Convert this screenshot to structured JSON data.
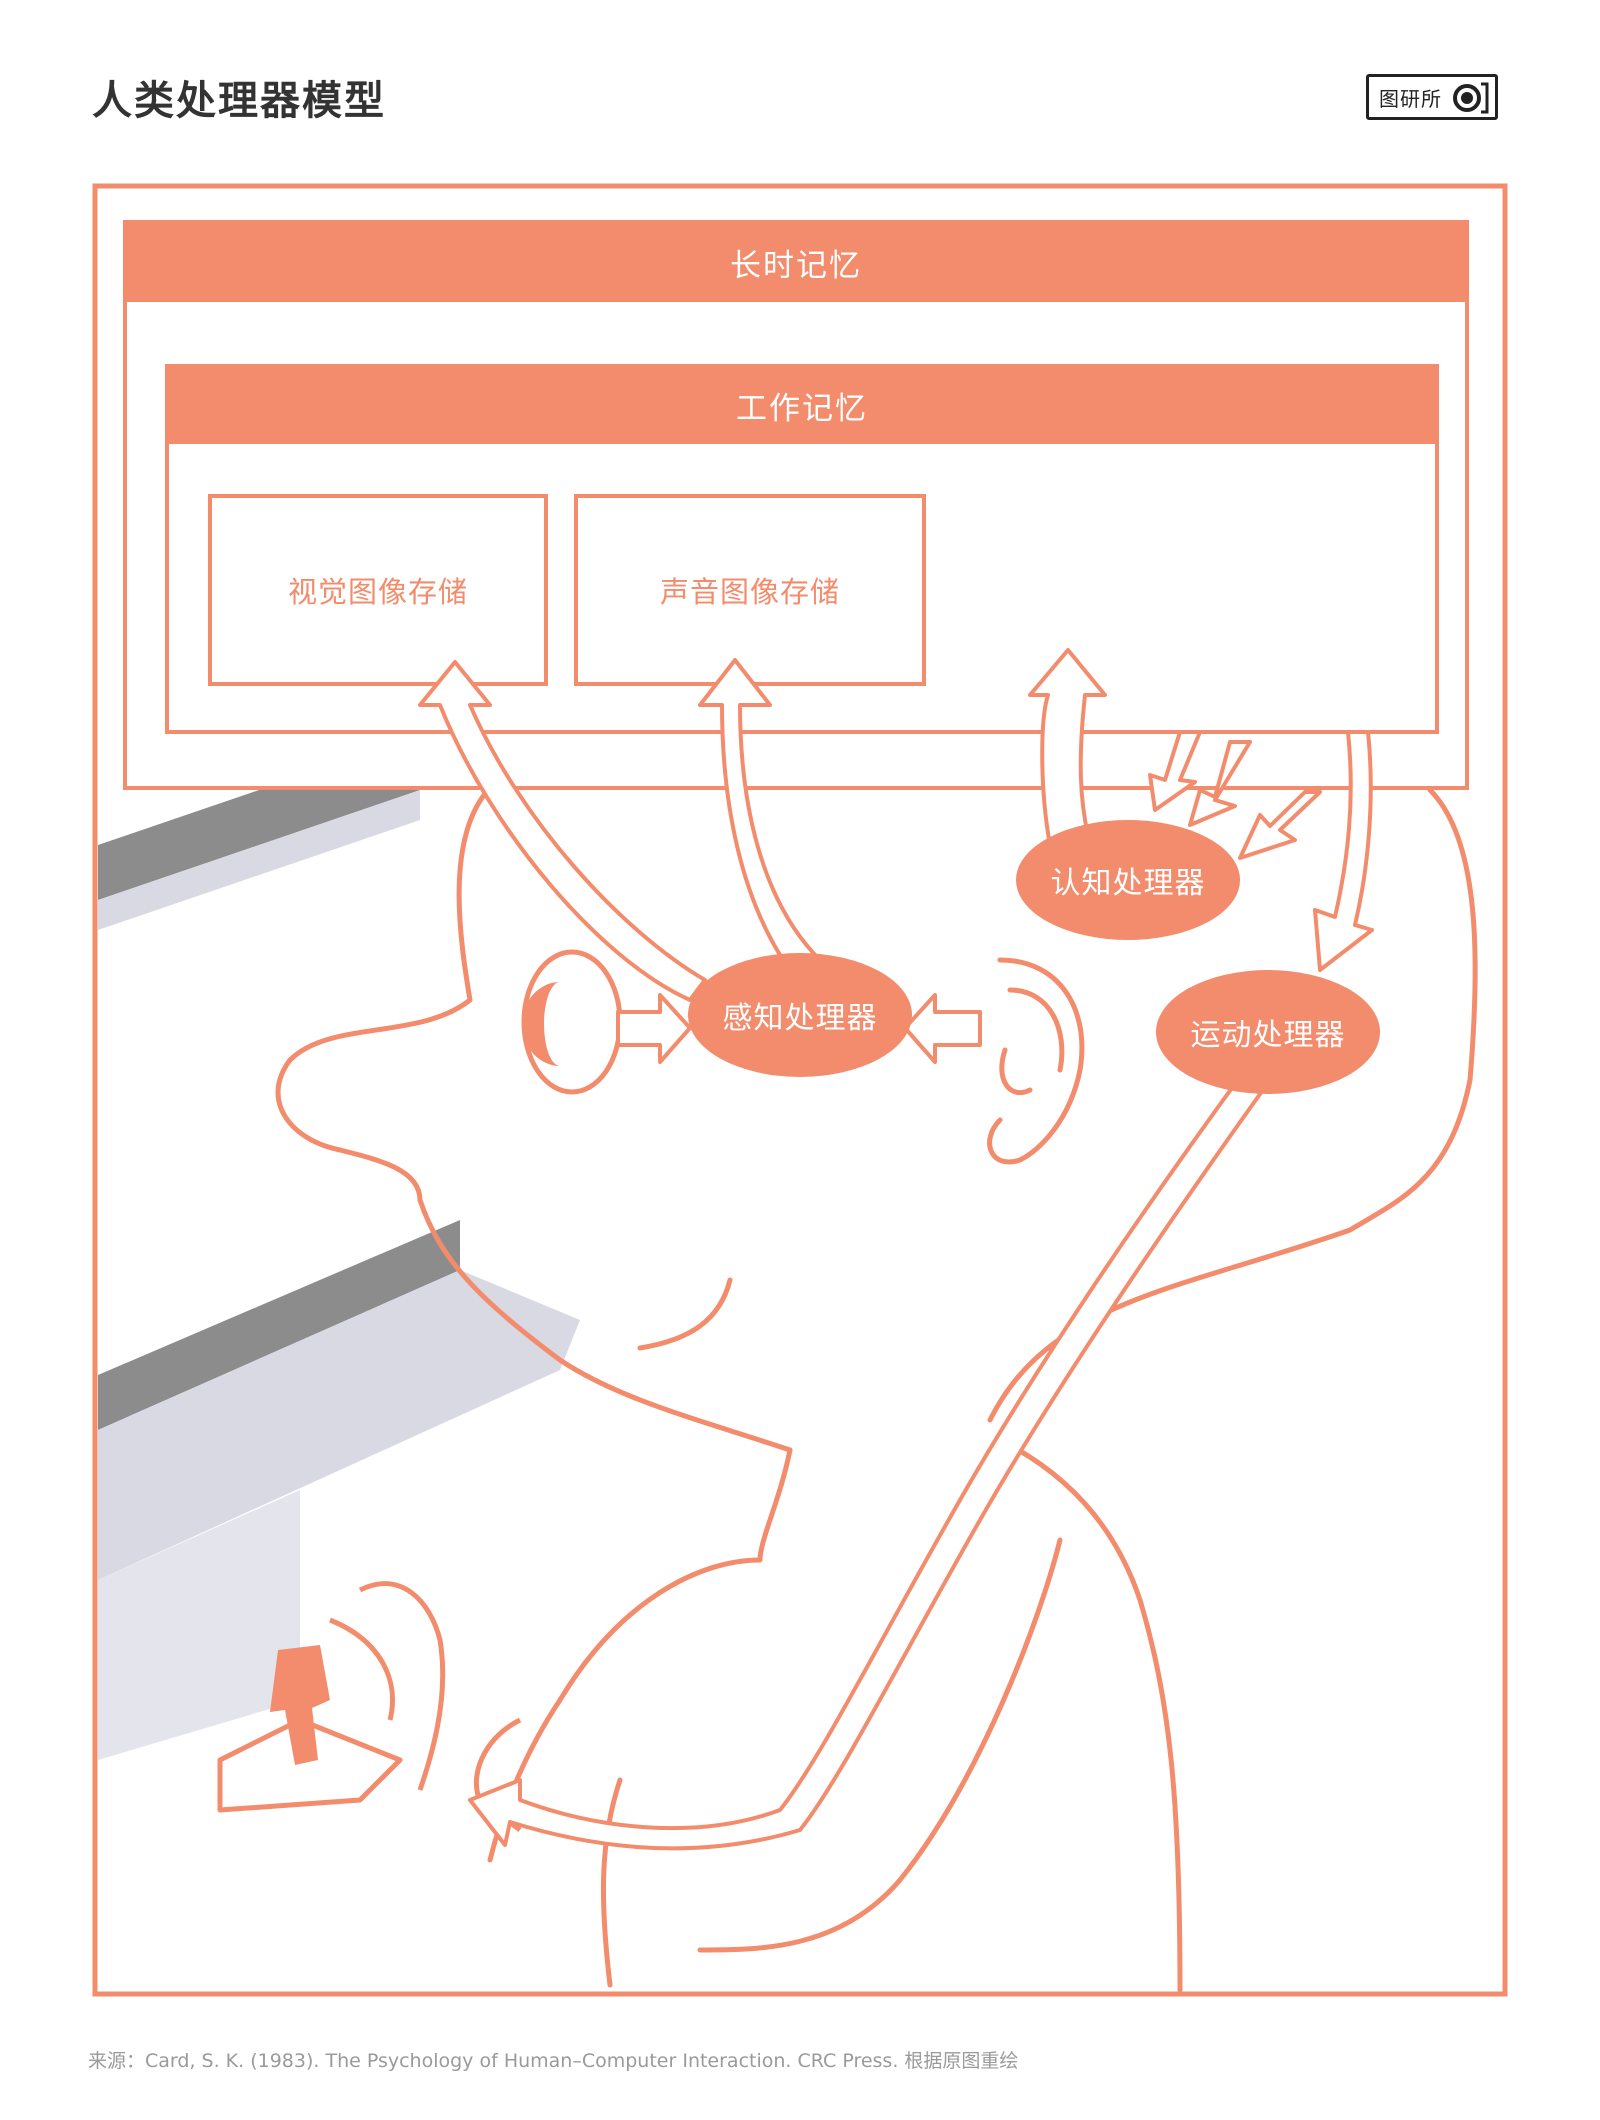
{
  "title": "人类处理器模型",
  "brand": {
    "logo_text": "图研所",
    "logo_mark_icon": "camera-lens-icon"
  },
  "colors": {
    "accent": "#f28c6c",
    "monitor_gray": "#8c8c8c",
    "monitor_light": "#d9d9e3"
  },
  "memory": {
    "long_term": "长时记忆",
    "working": "工作记忆",
    "visual_store": "视觉图像存储",
    "auditory_store": "声音图像存储"
  },
  "processors": {
    "perceptual": "感知处理器",
    "cognitive": "认知处理器",
    "motor": "运动处理器"
  },
  "source": "来源：Card, S. K. (1983). The Psychology of Human–Computer Interaction. CRC Press. 根据原图重绘"
}
